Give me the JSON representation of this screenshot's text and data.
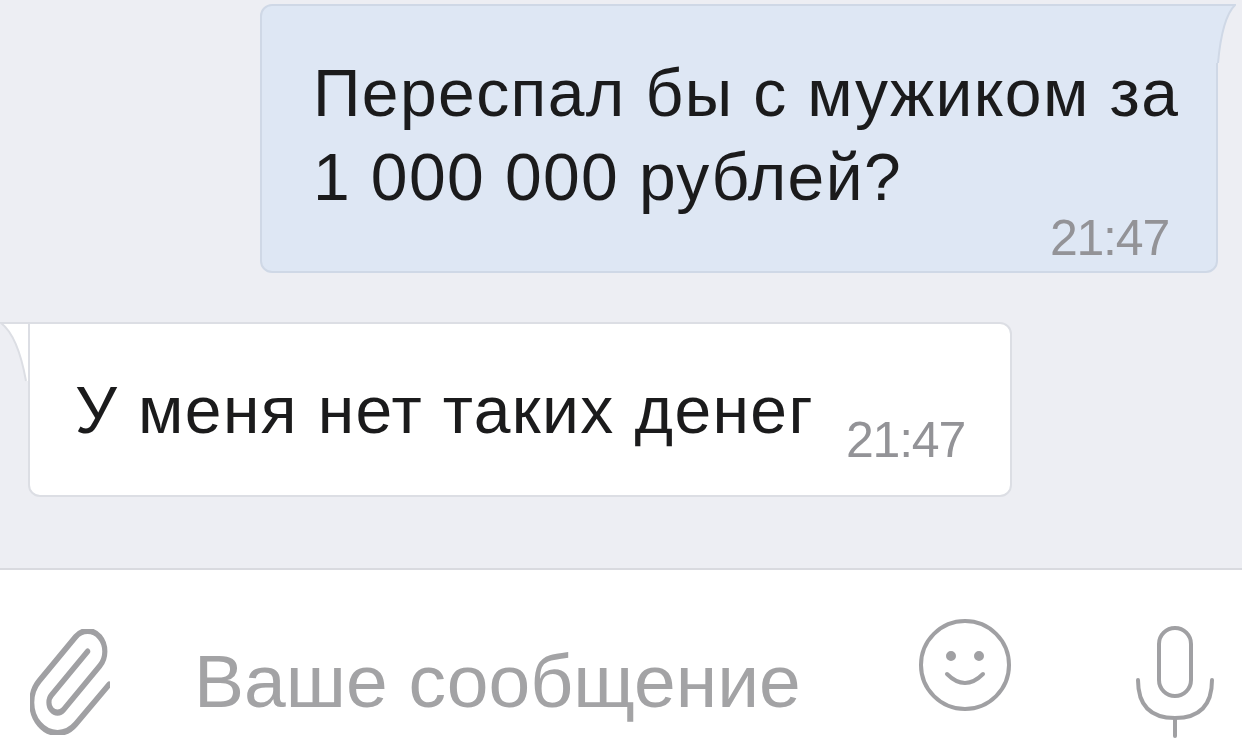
{
  "messages": [
    {
      "kind": "outgoing",
      "text": "Переспал бы с мужиком за 1 000 000 рублей?",
      "time": "21:47"
    },
    {
      "kind": "incoming",
      "text": "У меня нет таких денег",
      "time": "21:47"
    }
  ],
  "composer": {
    "placeholder": "Ваше сообщение"
  }
}
